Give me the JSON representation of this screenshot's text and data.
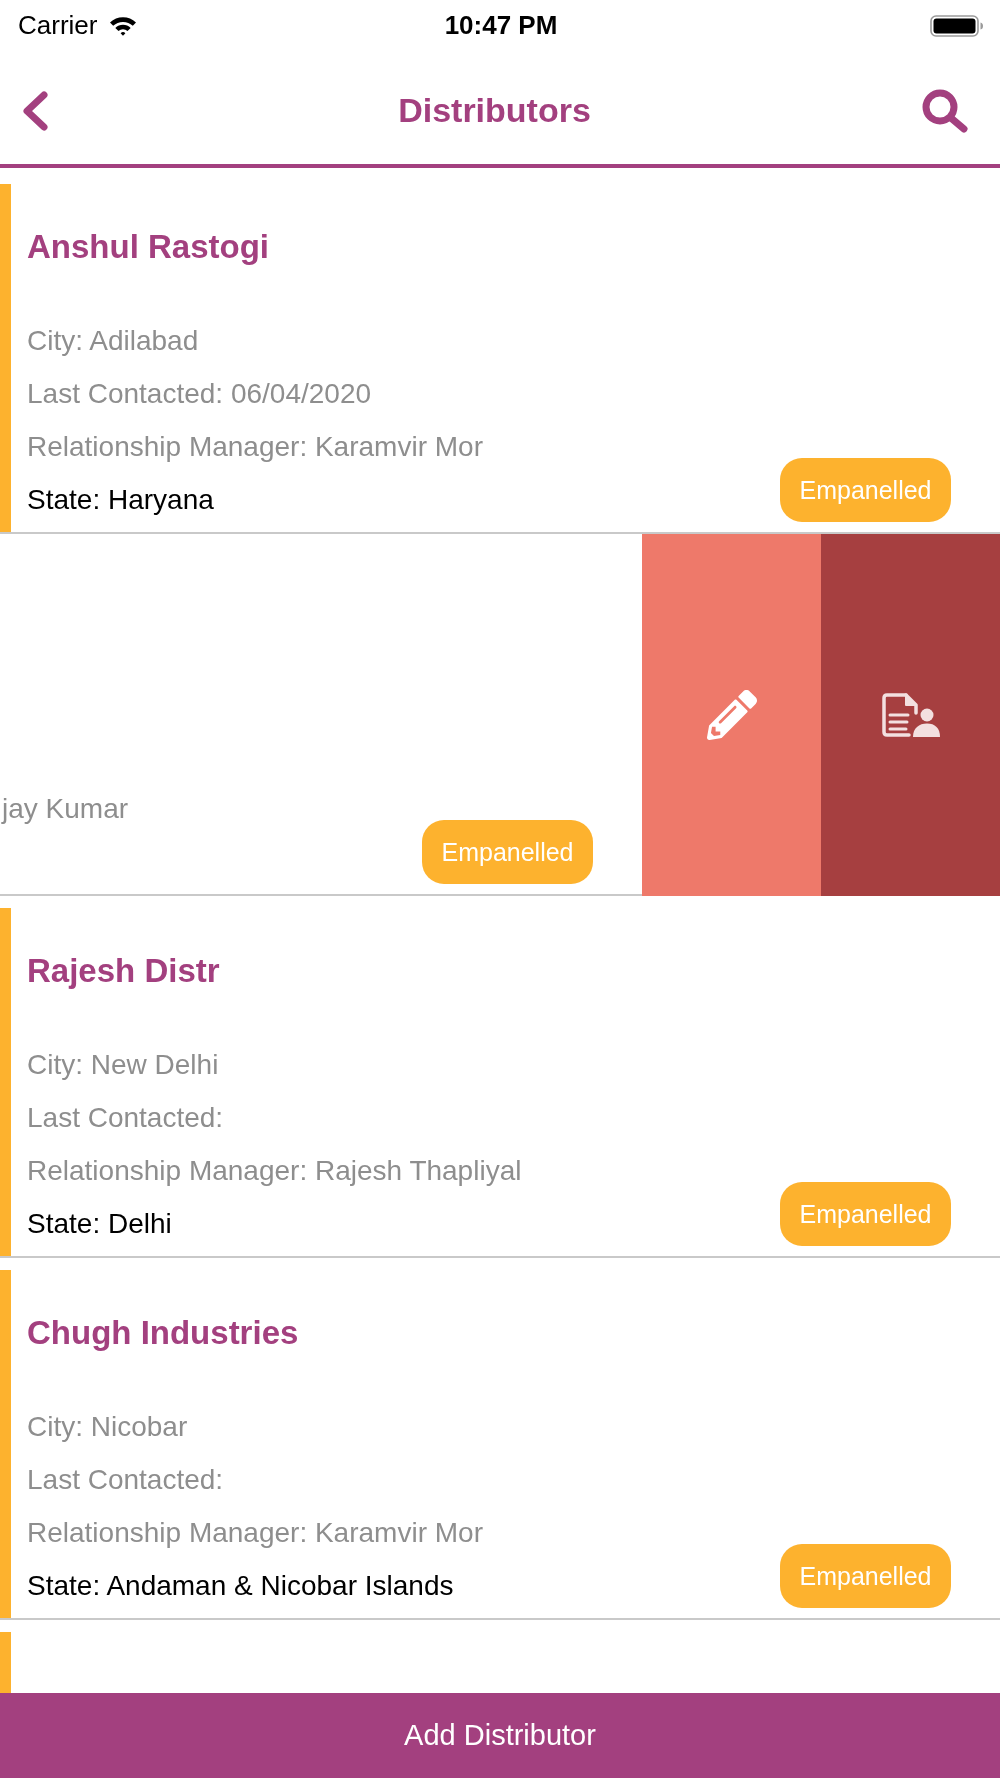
{
  "status_bar": {
    "carrier": "Carrier",
    "time": "10:47 PM"
  },
  "header": {
    "title": "Distributors"
  },
  "distributors": [
    {
      "kind": "card",
      "name": "Anshul Rastogi",
      "city": "City: Adilabad",
      "last_contacted": "Last Contacted: 06/04/2020",
      "manager": "Relationship Manager: Karamvir Mor",
      "state": "State: Haryana",
      "status": "Empanelled"
    },
    {
      "kind": "swiped",
      "manager": "jay Kumar",
      "status": "Empanelled",
      "actions": [
        {
          "kind": "edit"
        },
        {
          "kind": "contact"
        }
      ]
    },
    {
      "kind": "card",
      "name": "Rajesh Distr",
      "city": "City: New Delhi",
      "last_contacted": "Last Contacted:",
      "manager": "Relationship Manager: Rajesh Thapliyal",
      "state": "State: Delhi",
      "status": "Empanelled"
    },
    {
      "kind": "card",
      "name": "Chugh Industries",
      "city": "City: Nicobar",
      "last_contacted": "Last Contacted:",
      "manager": "Relationship Manager: Karamvir Mor",
      "state": "State: Andaman & Nicobar Islands",
      "status": "Empanelled"
    },
    {
      "kind": "covered"
    }
  ],
  "add_button": {
    "label": "Add Distributor"
  }
}
